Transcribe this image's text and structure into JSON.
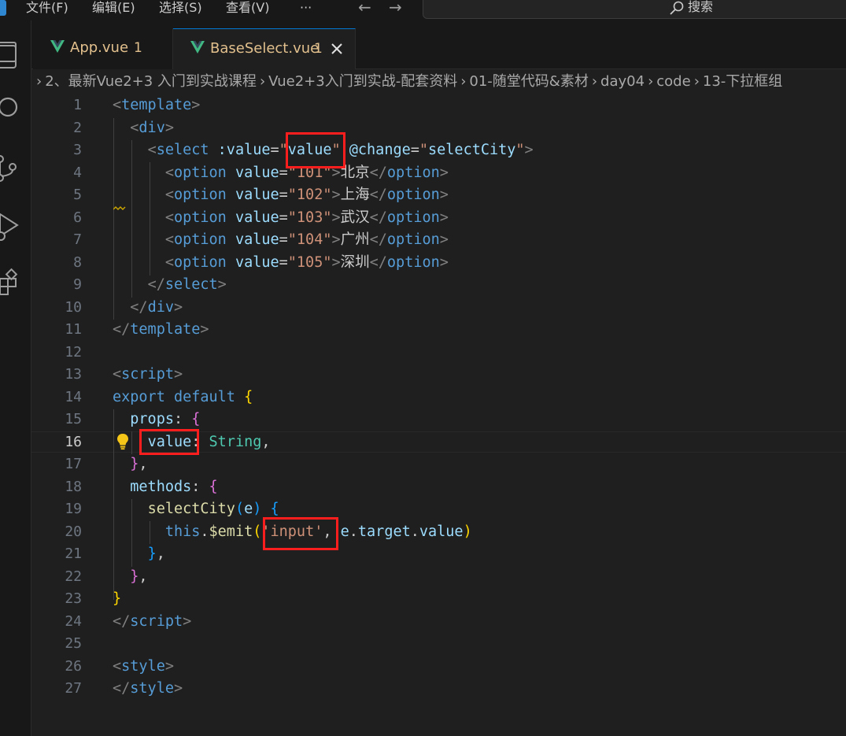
{
  "menu": {
    "items": [
      "文件(F)",
      "编辑(E)",
      "选择(S)",
      "查看(V)",
      "···"
    ],
    "back_arrow": "←",
    "forward_arrow": "→",
    "search_label": "搜索"
  },
  "tabs": [
    {
      "label": "App.vue",
      "count": "1",
      "active": false
    },
    {
      "label": "BaseSelect.vue",
      "count": "1",
      "active": true,
      "close": "✕"
    }
  ],
  "breadcrumb": {
    "chevron": "›",
    "items": [
      "2、最新Vue2+3 入门到实战课程",
      "Vue2+3入门到实战-配套资料",
      "01-随堂代码&素材",
      "day04",
      "code",
      "13-下拉框组"
    ]
  },
  "editor": {
    "active_line": 16,
    "line_numbers": [
      "1",
      "2",
      "3",
      "4",
      "5",
      "6",
      "7",
      "8",
      "9",
      "10",
      "11",
      "12",
      "13",
      "14",
      "15",
      "16",
      "17",
      "18",
      "19",
      "20",
      "21",
      "22",
      "23",
      "24",
      "25",
      "26",
      "27"
    ],
    "lines": [
      [
        [
          "t-gray",
          "<"
        ],
        [
          "t-tag",
          "template"
        ],
        [
          "t-gray",
          ">"
        ]
      ],
      [
        [
          "t-white",
          "  "
        ],
        [
          "t-gray",
          "<"
        ],
        [
          "t-tag",
          "div"
        ],
        [
          "t-gray",
          ">"
        ]
      ],
      [
        [
          "t-white",
          "    "
        ],
        [
          "t-gray",
          "<"
        ],
        [
          "t-tag",
          "select"
        ],
        [
          "t-white",
          " "
        ],
        [
          "t-attr",
          ":value"
        ],
        [
          "t-white",
          "="
        ],
        [
          "t-str",
          "\""
        ],
        [
          "t-attr",
          "value"
        ],
        [
          "t-str",
          "\""
        ],
        [
          "t-white",
          " "
        ],
        [
          "t-attr",
          "@change"
        ],
        [
          "t-white",
          "="
        ],
        [
          "t-str",
          "\""
        ],
        [
          "t-attr",
          "selectCity"
        ],
        [
          "t-str",
          "\""
        ],
        [
          "t-gray",
          ">"
        ]
      ],
      [
        [
          "t-white",
          "      "
        ],
        [
          "t-gray",
          "<"
        ],
        [
          "t-tag",
          "option"
        ],
        [
          "t-white",
          " "
        ],
        [
          "t-attr",
          "value"
        ],
        [
          "t-white",
          "="
        ],
        [
          "t-str",
          "\"101\""
        ],
        [
          "t-gray",
          ">"
        ],
        [
          "t-white",
          "北京"
        ],
        [
          "t-gray",
          "</"
        ],
        [
          "t-tag",
          "option"
        ],
        [
          "t-gray",
          ">"
        ]
      ],
      [
        [
          "t-white",
          "      "
        ],
        [
          "t-gray",
          "<"
        ],
        [
          "t-tag",
          "option"
        ],
        [
          "t-white",
          " "
        ],
        [
          "t-attr",
          "value"
        ],
        [
          "t-white",
          "="
        ],
        [
          "t-str",
          "\"102\""
        ],
        [
          "t-gray",
          ">"
        ],
        [
          "t-white",
          "上海"
        ],
        [
          "t-gray",
          "</"
        ],
        [
          "t-tag",
          "option"
        ],
        [
          "t-gray",
          ">"
        ]
      ],
      [
        [
          "t-white",
          "      "
        ],
        [
          "t-gray",
          "<"
        ],
        [
          "t-tag",
          "option"
        ],
        [
          "t-white",
          " "
        ],
        [
          "t-attr",
          "value"
        ],
        [
          "t-white",
          "="
        ],
        [
          "t-str",
          "\"103\""
        ],
        [
          "t-gray",
          ">"
        ],
        [
          "t-white",
          "武汉"
        ],
        [
          "t-gray",
          "</"
        ],
        [
          "t-tag",
          "option"
        ],
        [
          "t-gray",
          ">"
        ]
      ],
      [
        [
          "t-white",
          "      "
        ],
        [
          "t-gray",
          "<"
        ],
        [
          "t-tag",
          "option"
        ],
        [
          "t-white",
          " "
        ],
        [
          "t-attr",
          "value"
        ],
        [
          "t-white",
          "="
        ],
        [
          "t-str",
          "\"104\""
        ],
        [
          "t-gray",
          ">"
        ],
        [
          "t-white",
          "广州"
        ],
        [
          "t-gray",
          "</"
        ],
        [
          "t-tag",
          "option"
        ],
        [
          "t-gray",
          ">"
        ]
      ],
      [
        [
          "t-white",
          "      "
        ],
        [
          "t-gray",
          "<"
        ],
        [
          "t-tag",
          "option"
        ],
        [
          "t-white",
          " "
        ],
        [
          "t-attr",
          "value"
        ],
        [
          "t-white",
          "="
        ],
        [
          "t-str",
          "\"105\""
        ],
        [
          "t-gray",
          ">"
        ],
        [
          "t-white",
          "深圳"
        ],
        [
          "t-gray",
          "</"
        ],
        [
          "t-tag",
          "option"
        ],
        [
          "t-gray",
          ">"
        ]
      ],
      [
        [
          "t-white",
          "    "
        ],
        [
          "t-gray",
          "</"
        ],
        [
          "t-tag",
          "select"
        ],
        [
          "t-gray",
          ">"
        ]
      ],
      [
        [
          "t-white",
          "  "
        ],
        [
          "t-gray",
          "</"
        ],
        [
          "t-tag",
          "div"
        ],
        [
          "t-gray",
          ">"
        ]
      ],
      [
        [
          "t-gray",
          "</"
        ],
        [
          "t-tag",
          "template"
        ],
        [
          "t-gray",
          ">"
        ]
      ],
      [],
      [
        [
          "t-gray",
          "<"
        ],
        [
          "t-tag",
          "script"
        ],
        [
          "t-gray",
          ">"
        ]
      ],
      [
        [
          "t-key",
          "export"
        ],
        [
          "t-white",
          " "
        ],
        [
          "t-key",
          "default"
        ],
        [
          "t-white",
          " "
        ],
        [
          "t-b1",
          "{"
        ]
      ],
      [
        [
          "t-white",
          "  "
        ],
        [
          "t-prop",
          "props"
        ],
        [
          "t-white",
          ": "
        ],
        [
          "t-b2",
          "{"
        ]
      ],
      [
        [
          "t-white",
          "    "
        ],
        [
          "t-prop",
          "value"
        ],
        [
          "t-white",
          ": "
        ],
        [
          "t-type",
          "String"
        ],
        [
          "t-white",
          ","
        ]
      ],
      [
        [
          "t-white",
          "  "
        ],
        [
          "t-b2",
          "}"
        ],
        [
          "t-white",
          ","
        ]
      ],
      [
        [
          "t-white",
          "  "
        ],
        [
          "t-prop",
          "methods"
        ],
        [
          "t-white",
          ": "
        ],
        [
          "t-b2",
          "{"
        ]
      ],
      [
        [
          "t-white",
          "    "
        ],
        [
          "t-fn",
          "selectCity"
        ],
        [
          "t-b3",
          "("
        ],
        [
          "t-prop",
          "e"
        ],
        [
          "t-b3",
          ")"
        ],
        [
          "t-white",
          " "
        ],
        [
          "t-b3",
          "{"
        ]
      ],
      [
        [
          "t-white",
          "      "
        ],
        [
          "t-key",
          "this"
        ],
        [
          "t-white",
          "."
        ],
        [
          "t-fn",
          "$emit"
        ],
        [
          "t-b1",
          "("
        ],
        [
          "t-str",
          "'input'"
        ],
        [
          "t-white",
          ", "
        ],
        [
          "t-prop",
          "e"
        ],
        [
          "t-white",
          "."
        ],
        [
          "t-prop",
          "target"
        ],
        [
          "t-white",
          "."
        ],
        [
          "t-prop",
          "value"
        ],
        [
          "t-b1",
          ")"
        ]
      ],
      [
        [
          "t-white",
          "    "
        ],
        [
          "t-b3",
          "}"
        ],
        [
          "t-white",
          ","
        ]
      ],
      [
        [
          "t-white",
          "  "
        ],
        [
          "t-b2",
          "}"
        ],
        [
          "t-white",
          ","
        ]
      ],
      [
        [
          "t-b1",
          "}"
        ]
      ],
      [
        [
          "t-gray",
          "</"
        ],
        [
          "t-tag",
          "script"
        ],
        [
          "t-gray",
          ">"
        ]
      ],
      [],
      [
        [
          "t-gray",
          "<"
        ],
        [
          "t-tag",
          "style"
        ],
        [
          "t-gray",
          ">"
        ]
      ],
      [
        [
          "t-gray",
          "</"
        ],
        [
          "t-tag",
          "style"
        ],
        [
          "t-gray",
          ">"
        ]
      ]
    ]
  },
  "colors": {
    "background": "#1f1f1f",
    "highlight_box": "#ff1e1e",
    "tag": "#569cd6",
    "attribute": "#9cdcfe",
    "string": "#ce9178",
    "tab_modified": "#e2c08d",
    "vue_green": "#41b883"
  }
}
